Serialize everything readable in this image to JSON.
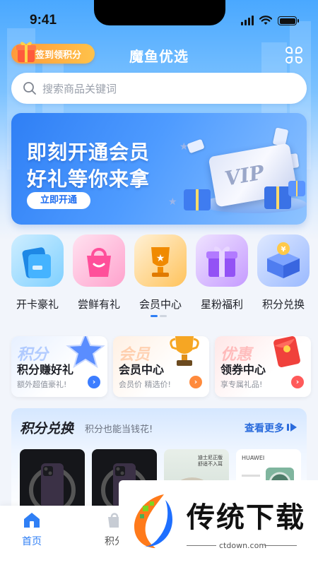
{
  "status_bar": {
    "time": "9:41"
  },
  "header": {
    "signin_label": "签到领积分",
    "title": "魔鱼优选",
    "menu_icon": "grid-flower-icon"
  },
  "search": {
    "placeholder": "搜索商品关键词",
    "icon": "search-icon"
  },
  "banner": {
    "line1": "即刻开通会员",
    "line2": "好礼等你来拿",
    "button": "立即开通",
    "card_text": "VIP"
  },
  "categories": [
    {
      "label": "开卡豪礼",
      "icon": "card-gift-icon",
      "color": "#35a7f5"
    },
    {
      "label": "尝鲜有礼",
      "icon": "shopping-bag-icon",
      "color": "#ff63a6"
    },
    {
      "label": "会员中心",
      "icon": "trophy-icon",
      "color": "#ffa51f"
    },
    {
      "label": "星粉福利",
      "icon": "gift-box-icon",
      "color": "#a36cff"
    },
    {
      "label": "积分兑换",
      "icon": "coin-box-icon",
      "color": "#4f84ff"
    }
  ],
  "carousel": {
    "pages": 2,
    "active": 0
  },
  "promos": [
    {
      "watermark": "积分",
      "title": "积分赚好礼",
      "subtitle": "额外超值豪礼!",
      "icon": "star-icon",
      "accent": "#3c7dff"
    },
    {
      "watermark": "会员",
      "title": "会员中心",
      "subtitle": "会员价 精选价!",
      "icon": "trophy-icon",
      "accent": "#ff8a3c"
    },
    {
      "watermark": "优惠",
      "title": "领券中心",
      "subtitle": "享专属礼品!",
      "icon": "red-envelope-icon",
      "accent": "#ff5a5a"
    }
  ],
  "points_section": {
    "title": "积分兑换",
    "subtitle": "积分也能当钱花!",
    "more": "查看更多",
    "products": [
      {
        "type": "phone",
        "caption": ""
      },
      {
        "type": "phone",
        "caption": ""
      },
      {
        "type": "earbuds",
        "caption": "迪士尼正版 舒适不入耳"
      },
      {
        "type": "huawei-phone",
        "caption": "HUAWEI"
      }
    ]
  },
  "tabbar": {
    "items": [
      {
        "label": "首页",
        "icon": "home-icon",
        "active": true
      },
      {
        "label": "积分",
        "icon": "bag-icon",
        "active": false
      }
    ]
  },
  "watermark": {
    "brand": "传统下载",
    "url": "ctdown.com"
  },
  "colors": {
    "primary": "#2a6bdc",
    "brand_blue": "#2f7ff5",
    "signin_orange": "#ff9a3a"
  }
}
